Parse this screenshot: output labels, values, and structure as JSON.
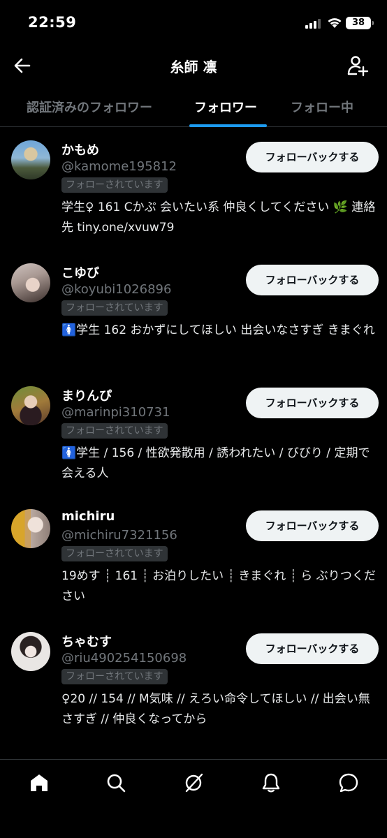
{
  "status_bar": {
    "time": "22:59",
    "battery": "38"
  },
  "header": {
    "title": "糸師 凛"
  },
  "tabs": [
    {
      "label": "認証済みのフォロワー",
      "active": false
    },
    {
      "label": "フォロワー",
      "active": true
    },
    {
      "label": "フォロー中",
      "active": false
    }
  ],
  "users": [
    {
      "name": "かもめ",
      "handle": "@kamome195812",
      "follows_you": "フォローされています",
      "bio": "学生♀ 161 Cかぷ 会いたい系 仲良くしてください 🌿 連絡先 tiny.one/xvuw79",
      "button": "フォローバックする"
    },
    {
      "name": "こゆび",
      "handle": "@koyubi1026896",
      "follows_you": "フォローされています",
      "bio": "🚺学生 162 おかずにしてほしい 出会いなさすぎ きまぐれ",
      "button": "フォローバックする"
    },
    {
      "name": "まりんぴ",
      "handle": "@marinpi310731",
      "follows_you": "フォローされています",
      "bio": "🚺学生 / 156 / 性欲発散用 / 誘われたい / びびり / 定期で会える人",
      "button": "フォローバックする"
    },
    {
      "name": "michiru",
      "handle": "@michiru7321156",
      "follows_you": "フォローされています",
      "bio": "19めす ┊ 161 ┊ お泊りしたい ┊ きまぐれ ┊ ら ぶりつください",
      "button": "フォローバックする"
    },
    {
      "name": "ちゃむす",
      "handle": "@riu490254150698",
      "follows_you": "フォローされています",
      "bio": "♀20 // 154 // M気味 // えろい命令してほしい // 出会い無さすぎ // 仲良くなってから",
      "button": "フォローバックする"
    }
  ],
  "bottom_nav": [
    {
      "icon": "home-icon",
      "active": true
    },
    {
      "icon": "search-icon",
      "active": false
    },
    {
      "icon": "grok-icon",
      "active": false
    },
    {
      "icon": "notifications-icon",
      "active": false
    },
    {
      "icon": "messages-icon",
      "active": false
    }
  ],
  "colors": {
    "background": "#000000",
    "accent": "#1d9bf0",
    "text_primary": "#e7e9ea",
    "text_secondary": "#71767b",
    "button_bg": "#eff3f4"
  }
}
